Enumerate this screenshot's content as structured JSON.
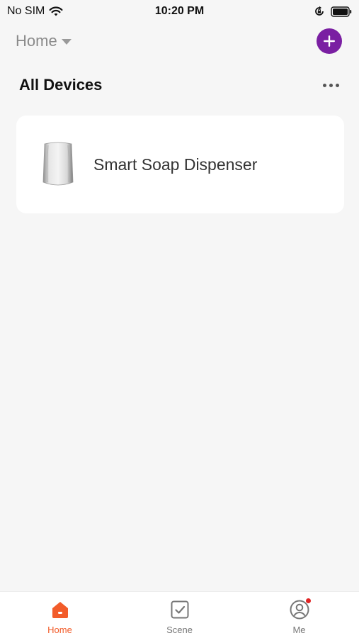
{
  "status_bar": {
    "carrier": "No SIM",
    "time": "10:20 PM"
  },
  "header": {
    "home_label": "Home"
  },
  "section": {
    "title": "All Devices"
  },
  "devices": [
    {
      "name": "Smart Soap Dispenser",
      "icon": "soap-dispenser-image"
    }
  ],
  "tabs": [
    {
      "label": "Home",
      "icon": "home-icon",
      "active": true
    },
    {
      "label": "Scene",
      "icon": "scene-checkbox-icon",
      "active": false
    },
    {
      "label": "Me",
      "icon": "profile-icon",
      "active": false,
      "has_notification": true
    }
  ],
  "colors": {
    "accent_add": "#7a1fa2",
    "active_tab": "#f25c2a",
    "notification": "#e02424"
  }
}
